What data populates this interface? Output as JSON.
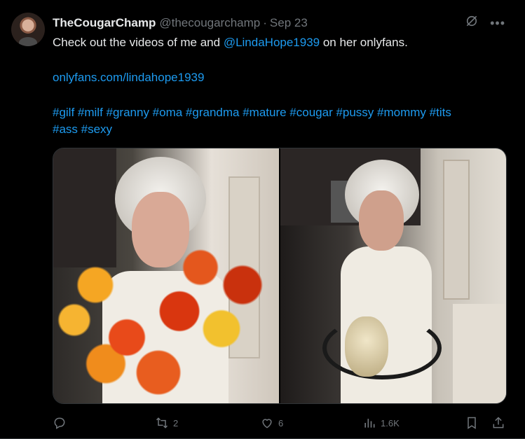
{
  "post": {
    "display_name": "TheCougarChamp",
    "handle": "@thecougarchamp",
    "separator": "·",
    "date": "Sep 23",
    "text": {
      "line1_before": "Check out the videos of me and ",
      "line1_mention": "@LindaHope1939",
      "line1_after": " on her onlyfans.",
      "link": "onlyfans.com/lindahope1939",
      "hashtags_line1": "#gilf #milf #granny #oma #grandma #mature #cougar #pussy #mommy #tits",
      "hashtags_line2": "#ass #sexy"
    },
    "icons": {
      "grok": "grok-icon",
      "more": "more-icon",
      "more_glyph": "•••"
    }
  },
  "actions": {
    "reply": {
      "icon": "reply-icon",
      "count": ""
    },
    "retweet": {
      "icon": "retweet-icon",
      "count": "2"
    },
    "like": {
      "icon": "heart-icon",
      "count": "6"
    },
    "views": {
      "icon": "views-icon",
      "count": "1.6K"
    },
    "bookmark": {
      "icon": "bookmark-icon"
    },
    "share": {
      "icon": "share-icon"
    }
  },
  "colors": {
    "background": "#000000",
    "text": "#e7e9ea",
    "secondary": "#71767b",
    "link": "#1d9bf0"
  }
}
